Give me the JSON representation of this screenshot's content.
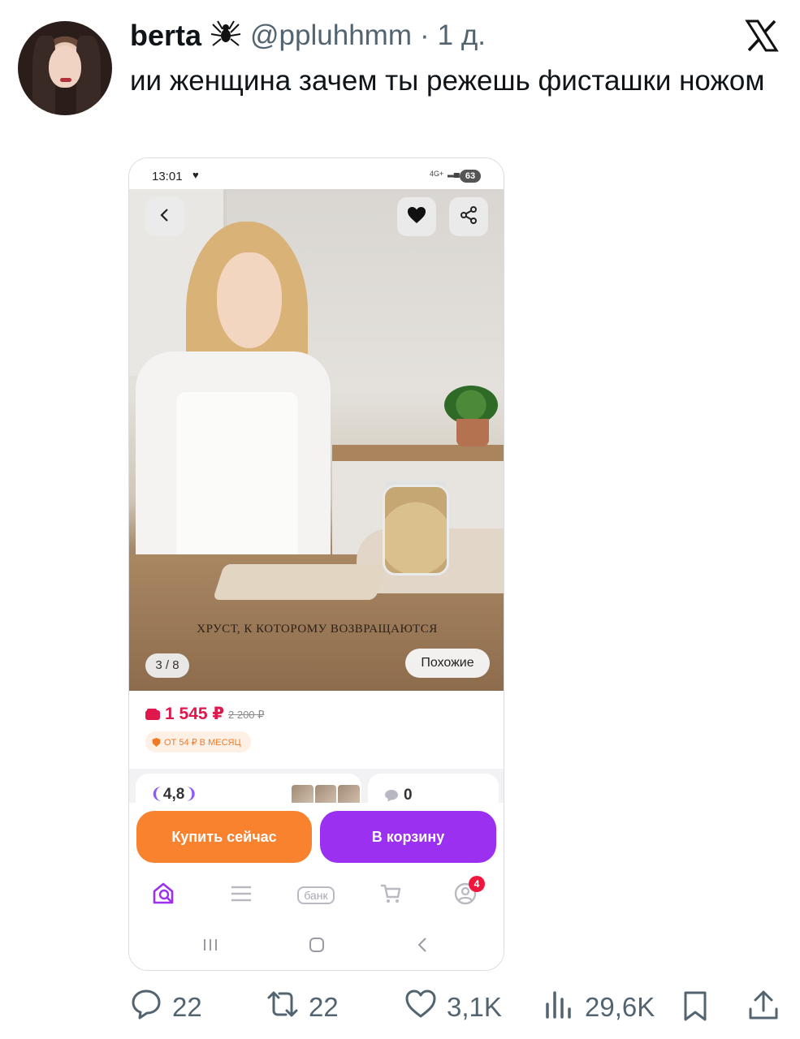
{
  "tweet": {
    "display_name": "berta",
    "name_emoji": "🕷",
    "handle": "@ppluhhmm",
    "separator": "·",
    "time": "1 д.",
    "text": "ии женщина зачем ты режешь фисташки ножом",
    "platform_logo": "x-logo-icon"
  },
  "screenshot": {
    "status_bar": {
      "time": "13:01",
      "network": "4G+",
      "battery": "63"
    },
    "photo": {
      "caption": "ХРУСТ, К КОТОРОМУ ВОЗВРАЩАЮТСЯ",
      "page_counter": "3 / 8",
      "similar_label": "Похожие"
    },
    "price": {
      "current": "1 545 ₽",
      "old": "2 200 ₽",
      "installment": "ОТ 54 ₽ В МЕСЯЦ"
    },
    "rating": {
      "value": "4,8"
    },
    "comments": {
      "count": "0"
    },
    "actions": {
      "buy_now": "Купить сейчас",
      "add_to_cart": "В корзину"
    },
    "tab_bar": {
      "bank_label": "банк",
      "profile_badge": "4"
    }
  },
  "engagement": {
    "replies": "22",
    "retweets": "22",
    "likes": "3,1K",
    "views": "29,6K"
  },
  "colors": {
    "accent_orange": "#f9822e",
    "accent_purple": "#9b30f0",
    "price_red": "#e0174a",
    "meta_gray": "#536471"
  }
}
